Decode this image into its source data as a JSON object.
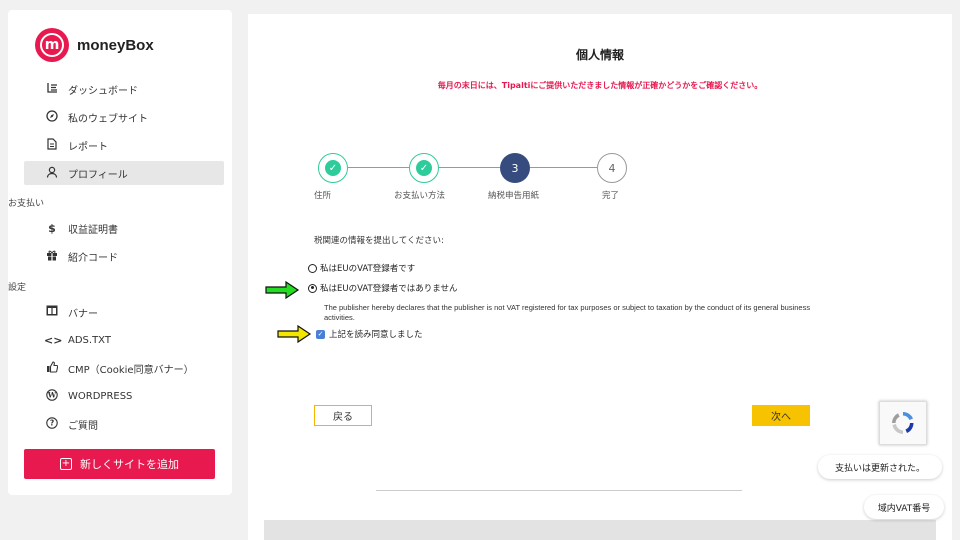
{
  "brand": {
    "name": "moneyBox",
    "logo_letter": "m",
    "color": "#e8194f"
  },
  "sidebar": {
    "items": [
      {
        "label": "ダッシュボード",
        "icon": "chart-icon"
      },
      {
        "label": "私のウェブサイト",
        "icon": "compass-icon"
      },
      {
        "label": "レポート",
        "icon": "document-icon"
      },
      {
        "label": "プロフィール",
        "icon": "user-icon",
        "active": true
      }
    ],
    "section_payments": "お支払い",
    "payment_items": [
      {
        "label": "収益証明書",
        "icon": "dollar-icon"
      },
      {
        "label": "紹介コード",
        "icon": "gift-icon"
      }
    ],
    "section_settings": "設定",
    "settings_items": [
      {
        "label": "バナー",
        "icon": "layout-icon"
      },
      {
        "label": "ADS.TXT",
        "icon": "code-icon"
      },
      {
        "label": "CMP（Cookie同意バナー）",
        "icon": "thumbs-up-icon"
      },
      {
        "label": "WORDPRESS",
        "icon": "wordpress-icon"
      },
      {
        "label": "ご質問",
        "icon": "question-icon"
      }
    ],
    "add_site_label": "新しくサイトを追加"
  },
  "main": {
    "title": "個人情報",
    "notice": "毎月の末日には、Tipaltiにご提供いただきました情報が正確かどうかをご確認ください。",
    "steps": [
      {
        "number": "1",
        "label": "住所",
        "state": "done"
      },
      {
        "number": "2",
        "label": "お支払い方法",
        "state": "done"
      },
      {
        "number": "3",
        "label": "納税申告用紙",
        "state": "current"
      },
      {
        "number": "4",
        "label": "完了",
        "state": "todo"
      }
    ],
    "tax_prompt": "税関連の情報を提出してください:",
    "options": [
      {
        "label": "私はEUのVAT登録者です",
        "checked": false
      },
      {
        "label": "私はEUのVAT登録者ではありません",
        "checked": true
      }
    ],
    "declaration": "The publisher hereby declares that the publisher is not VAT registered for tax purposes or subject to taxation by the conduct of its general business activities.",
    "agree_label": "上記を読み同意しました",
    "agree_checked": true,
    "back_label": "戻る",
    "next_label": "次へ"
  },
  "floating": {
    "payment_updated": "支払いは更新された。",
    "vat_number": "域内VAT番号"
  },
  "colors": {
    "step_done": "#2ecc9a",
    "step_current": "#374c7e",
    "button": "#f7c200",
    "arrow_green": "#22dd22",
    "arrow_yellow": "#f5e600"
  }
}
